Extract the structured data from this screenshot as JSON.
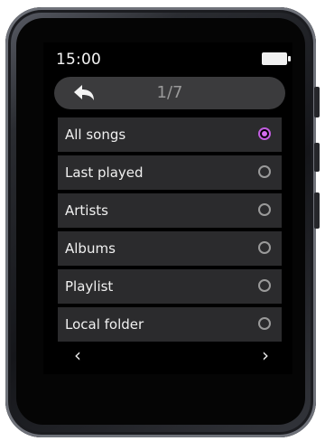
{
  "status": {
    "time": "15:00",
    "battery_icon": "battery-full-icon"
  },
  "header": {
    "back_icon": "back-arrow-icon",
    "page_indicator": "1/7"
  },
  "menu": {
    "items": [
      {
        "label": "All songs",
        "selected": true
      },
      {
        "label": "Last played",
        "selected": false
      },
      {
        "label": "Artists",
        "selected": false
      },
      {
        "label": "Albums",
        "selected": false
      },
      {
        "label": "Playlist",
        "selected": false
      },
      {
        "label": "Local folder",
        "selected": false
      }
    ]
  },
  "navigation": {
    "prev_glyph": "‹",
    "next_glyph": "›"
  },
  "colors": {
    "accent": "#c25de0",
    "row_background": "#2b2b2d",
    "header_background": "#3b3b3d"
  }
}
